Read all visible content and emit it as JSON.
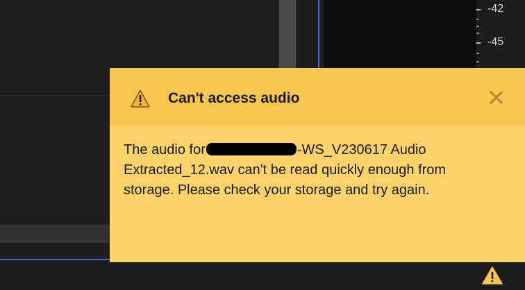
{
  "meter": {
    "labels": [
      "-42",
      "-45"
    ]
  },
  "notification": {
    "title": "Can't access audio",
    "body_prefix": "The audio for",
    "body_after_redaction": "-WS_V230617 Audio",
    "body_line2": "Extracted_12.wav can't be read quickly enough from",
    "body_line3": "storage. Please check your storage and try again.",
    "icon": "warning-icon",
    "close_icon": "close-icon",
    "background_color": "#fcd26b",
    "header_color": "#f7c64e"
  },
  "statusbar": {
    "icon": "warning-icon",
    "icon_color": "#f7c64e"
  }
}
